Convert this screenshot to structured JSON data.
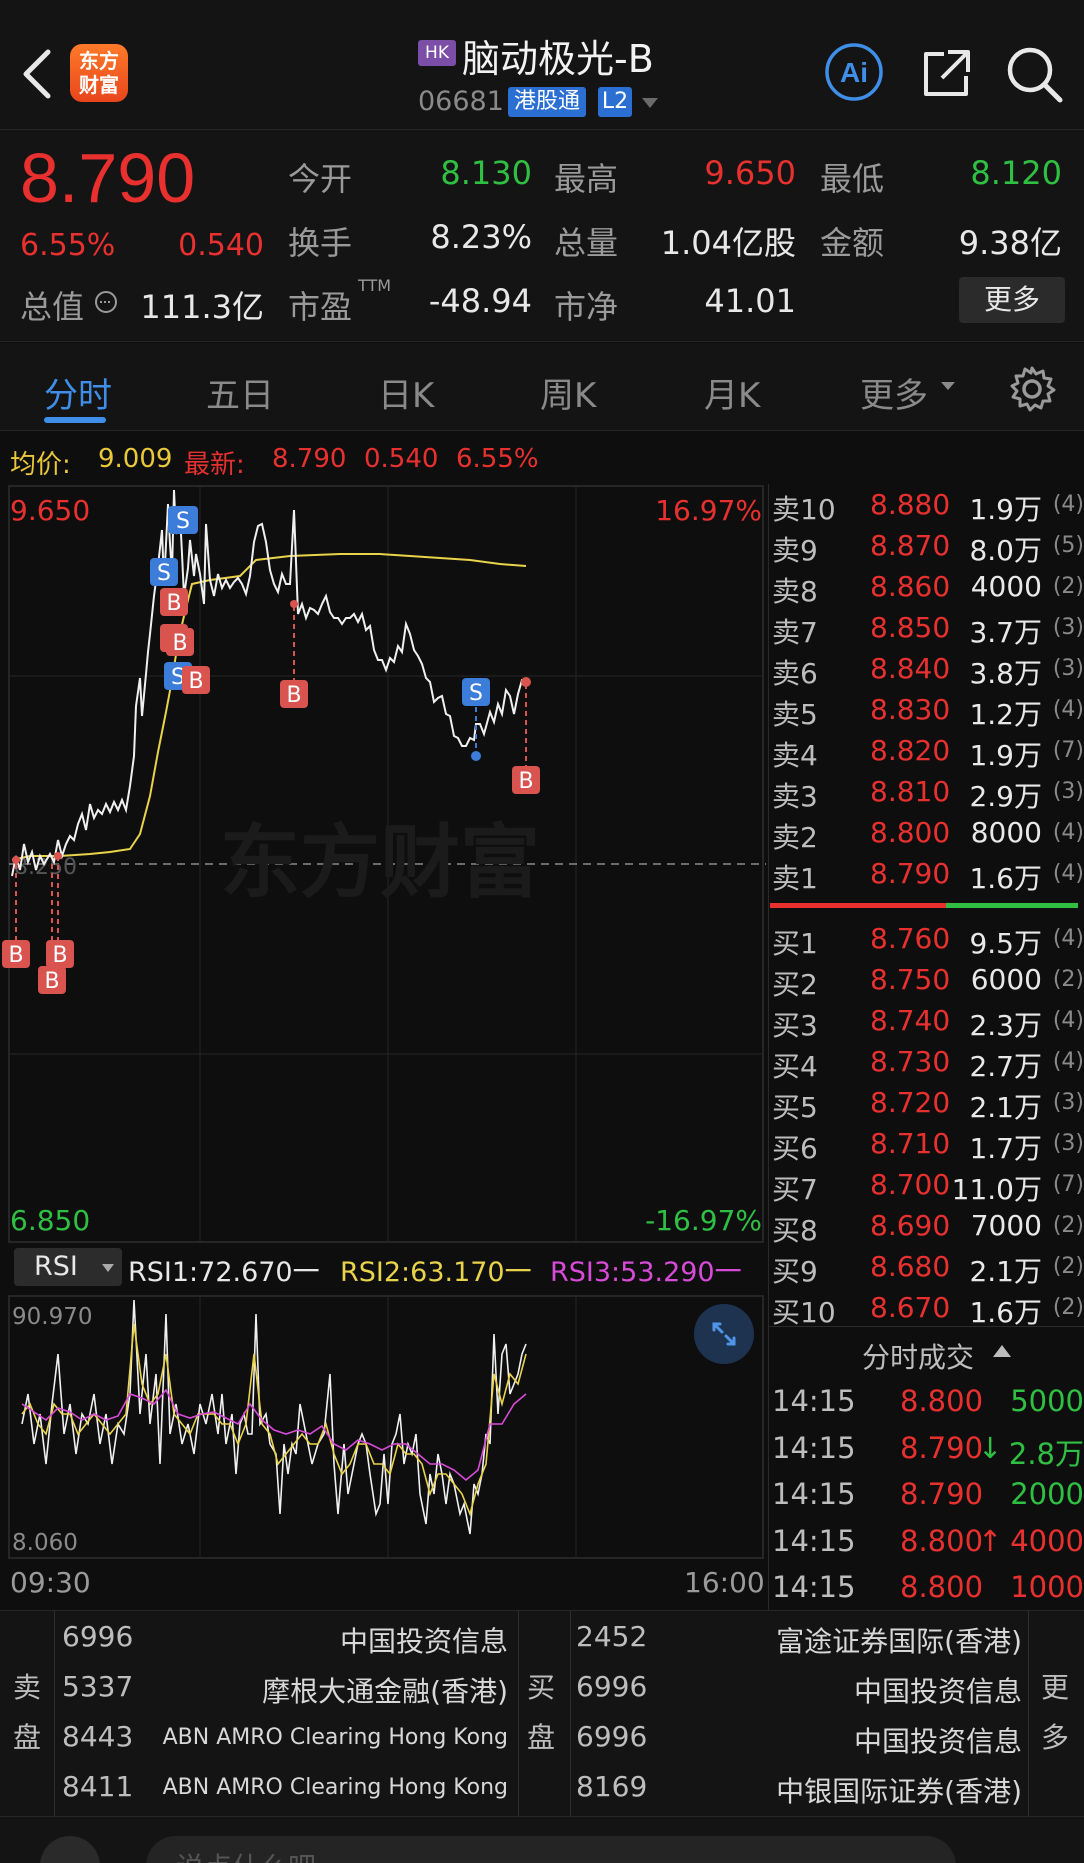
{
  "header": {
    "market_tag": "HK",
    "stock_name": "脑动极光-B",
    "stock_code": "06681",
    "connect_tag": "港股通",
    "level_tag": "L2",
    "logo_text_1": "东方",
    "logo_text_2": "财富",
    "ai_label": "Ai"
  },
  "quote": {
    "price": "8.790",
    "change_pct": "6.55%",
    "change": "0.540",
    "open_label": "今开",
    "open": "8.130",
    "high_label": "最高",
    "high": "9.650",
    "low_label": "最低",
    "low": "8.120",
    "turnover_label": "换手",
    "turnover": "8.23%",
    "volume_label": "总量",
    "volume": "1.04亿股",
    "amount_label": "金额",
    "amount": "9.38亿",
    "mktcap_label": "总值",
    "mktcap": "111.3亿",
    "pe_label": "市盈",
    "pe_sup": "TTM",
    "pe": "-48.94",
    "pb_label": "市净",
    "pb": "41.01",
    "more_label": "更多"
  },
  "tabs": [
    "分时",
    "五日",
    "日K",
    "周K",
    "月K",
    "更多"
  ],
  "info_line": {
    "avg_label": "均价:",
    "avg": "9.009",
    "latest_label": "最新:",
    "latest": "8.790",
    "change": "0.540",
    "change_pct": "6.55%"
  },
  "chart": {
    "y_max": "9.650",
    "y_min": "6.850",
    "pct_max": "16.97%",
    "pct_min": "-16.97%",
    "prev_close": "8.250",
    "watermark": "东方财富",
    "time_start": "09:30",
    "time_end": "16:00",
    "colors": {
      "price": "#ffffff",
      "avg": "#e9d34a",
      "up": "#e8312f",
      "down": "#2fc043",
      "buy_marker": "#d9534f",
      "sell_marker": "#3b7dd8"
    }
  },
  "rsi": {
    "selector": "RSI",
    "rsi1": "RSI1:72.670一",
    "rsi2": "RSI2:63.170一",
    "rsi3": "RSI3:53.290一",
    "max": "90.970",
    "min": "8.060"
  },
  "order_book": {
    "asks": [
      {
        "label": "卖10",
        "price": "8.880",
        "vol": "1.9万",
        "count": "(4)"
      },
      {
        "label": "卖9",
        "price": "8.870",
        "vol": "8.0万",
        "count": "(5)"
      },
      {
        "label": "卖8",
        "price": "8.860",
        "vol": "4000",
        "count": "(2)"
      },
      {
        "label": "卖7",
        "price": "8.850",
        "vol": "3.7万",
        "count": "(3)"
      },
      {
        "label": "卖6",
        "price": "8.840",
        "vol": "3.8万",
        "count": "(3)"
      },
      {
        "label": "卖5",
        "price": "8.830",
        "vol": "1.2万",
        "count": "(4)"
      },
      {
        "label": "卖4",
        "price": "8.820",
        "vol": "1.9万",
        "count": "(7)"
      },
      {
        "label": "卖3",
        "price": "8.810",
        "vol": "2.9万",
        "count": "(3)"
      },
      {
        "label": "卖2",
        "price": "8.800",
        "vol": "8000",
        "count": "(4)"
      },
      {
        "label": "卖1",
        "price": "8.790",
        "vol": "1.6万",
        "count": "(4)"
      }
    ],
    "bids": [
      {
        "label": "买1",
        "price": "8.760",
        "vol": "9.5万",
        "count": "(4)"
      },
      {
        "label": "买2",
        "price": "8.750",
        "vol": "6000",
        "count": "(2)"
      },
      {
        "label": "买3",
        "price": "8.740",
        "vol": "2.3万",
        "count": "(4)"
      },
      {
        "label": "买4",
        "price": "8.730",
        "vol": "2.7万",
        "count": "(4)"
      },
      {
        "label": "买5",
        "price": "8.720",
        "vol": "2.1万",
        "count": "(3)"
      },
      {
        "label": "买6",
        "price": "8.710",
        "vol": "1.7万",
        "count": "(3)"
      },
      {
        "label": "买7",
        "price": "8.700",
        "vol": "11.0万",
        "count": "(7)"
      },
      {
        "label": "买8",
        "price": "8.690",
        "vol": "7000",
        "count": "(2)"
      },
      {
        "label": "买9",
        "price": "8.680",
        "vol": "2.1万",
        "count": "(2)"
      },
      {
        "label": "买10",
        "price": "8.670",
        "vol": "1.6万",
        "count": "(2)"
      }
    ]
  },
  "trades": {
    "title": "分时成交",
    "rows": [
      {
        "time": "14:15",
        "price": "8.800",
        "arrow": "",
        "vol": "5000",
        "vol_color": "green"
      },
      {
        "time": "14:15",
        "price": "8.790",
        "arrow": "↓",
        "vol": "2.8万",
        "vol_color": "green"
      },
      {
        "time": "14:15",
        "price": "8.790",
        "arrow": "",
        "vol": "2000",
        "vol_color": "green"
      },
      {
        "time": "14:15",
        "price": "8.800",
        "arrow": "↑",
        "vol": "4000",
        "vol_color": "red"
      },
      {
        "time": "14:15",
        "price": "8.800",
        "arrow": "",
        "vol": "1000",
        "vol_color": "red"
      }
    ]
  },
  "brokers": {
    "sell_label_1": "卖",
    "sell_label_2": "盘",
    "buy_label_1": "买",
    "buy_label_2": "盘",
    "more_label_1": "更",
    "more_label_2": "多",
    "sell": [
      {
        "code": "6996",
        "name": "中国投资信息"
      },
      {
        "code": "5337",
        "name": "摩根大通金融(香港)"
      },
      {
        "code": "8443",
        "name": "ABN AMRO Clearing Hong Kong"
      },
      {
        "code": "8411",
        "name": "ABN AMRO Clearing Hong Kong"
      }
    ],
    "buy": [
      {
        "code": "2452",
        "name": "富途证券国际(香港)"
      },
      {
        "code": "6996",
        "name": "中国投资信息"
      },
      {
        "code": "6996",
        "name": "中国投资信息"
      },
      {
        "code": "8169",
        "name": "中银国际证券(香港)"
      }
    ]
  },
  "bottom": {
    "comment_placeholder": "说点什么吧"
  }
}
